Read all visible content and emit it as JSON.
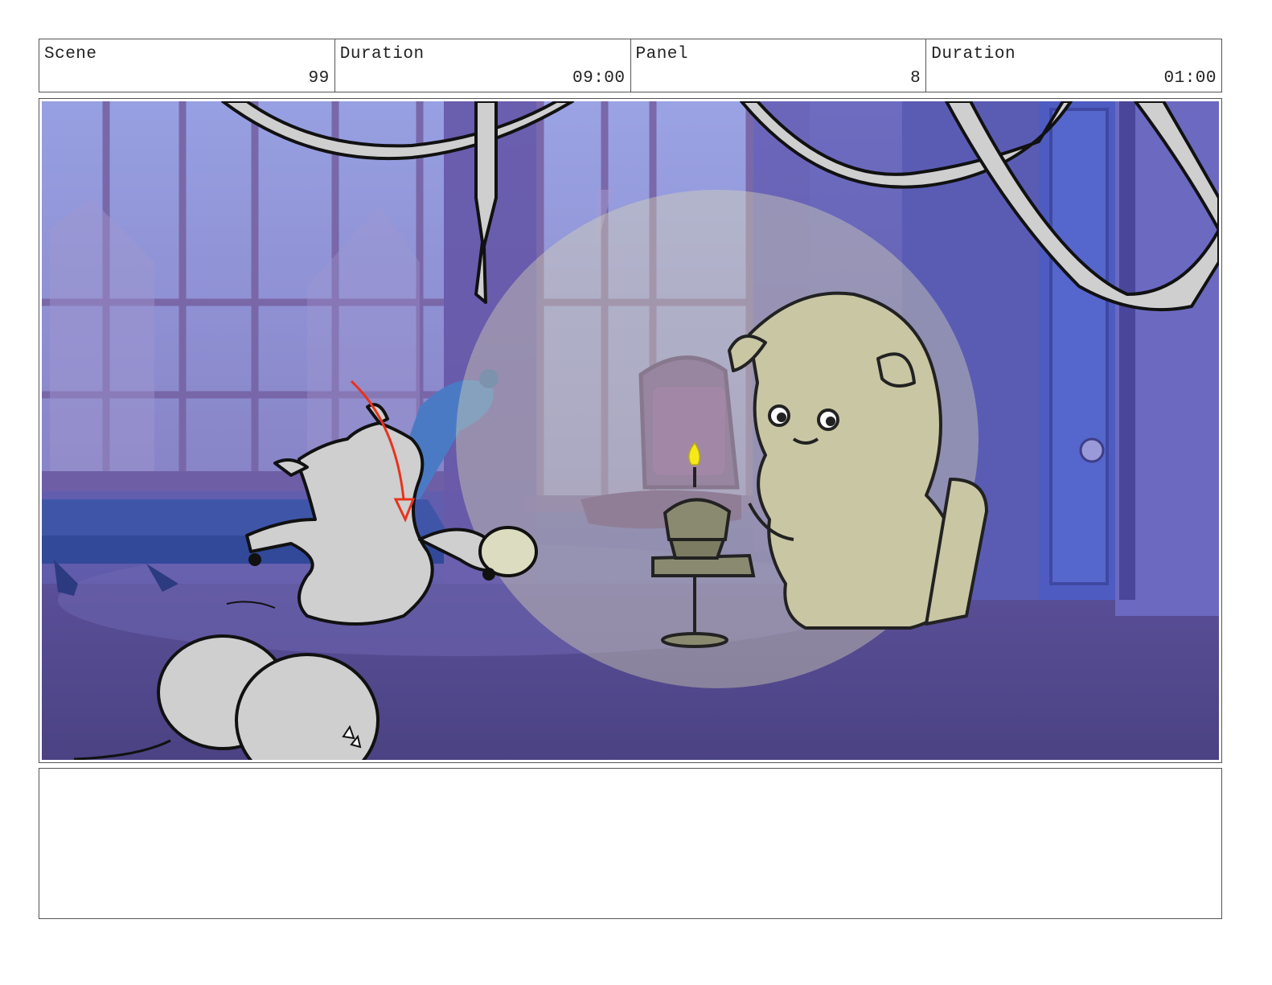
{
  "header": {
    "scene_label": "Scene",
    "scene_value": "99",
    "scene_duration_label": "Duration",
    "scene_duration_value": "09:00",
    "panel_label": "Panel",
    "panel_value": "8",
    "panel_duration_label": "Duration",
    "panel_duration_value": "01:00"
  },
  "colors": {
    "room": "#5c5aa8",
    "floor": "#4f4589",
    "window_pane": "#8f96d8",
    "window_frame": "#7b6aa8",
    "sketch_gray": "#cfcfcf",
    "sketch_khaki": "#c9c6a4",
    "spotlight": "#d8d7b4",
    "motion_arrow": "#e8331c",
    "candle_flame": "#f7e81a"
  },
  "notes": {
    "text": ""
  }
}
